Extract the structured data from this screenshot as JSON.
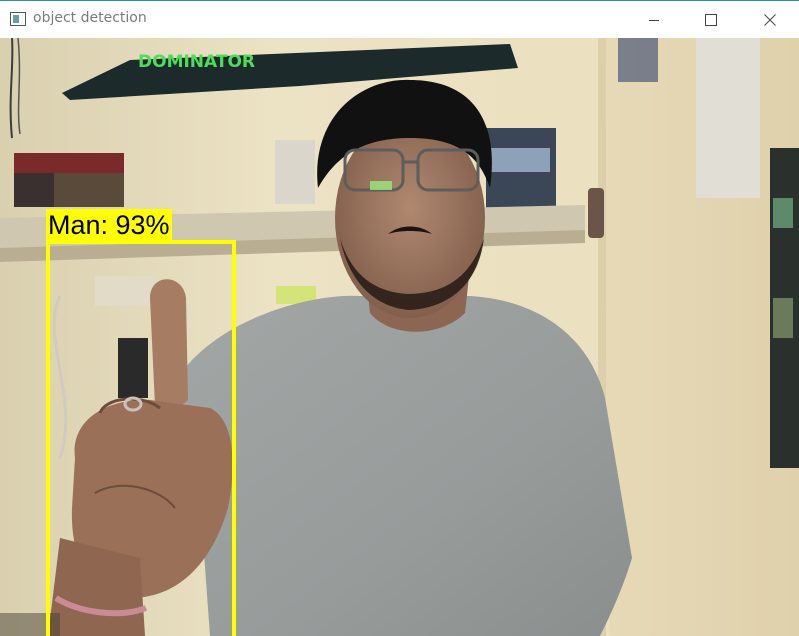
{
  "window": {
    "title": "object detection",
    "icon": "opencv-window-icon",
    "controls": {
      "minimize_icon": "minimize-icon",
      "maximize_icon": "maximize-icon",
      "close_icon": "close-icon"
    }
  },
  "detection": {
    "label": "Man: 93%",
    "class": "Man",
    "confidence_percent": 93,
    "box_color": "#ffff00",
    "label_background": "#ffff00",
    "label_text_color": "#000000"
  },
  "scene": {
    "shelf_board_text": "DOMINATOR",
    "wall_color": "#ece3c4",
    "shirt_color": "#9a9f9e"
  }
}
